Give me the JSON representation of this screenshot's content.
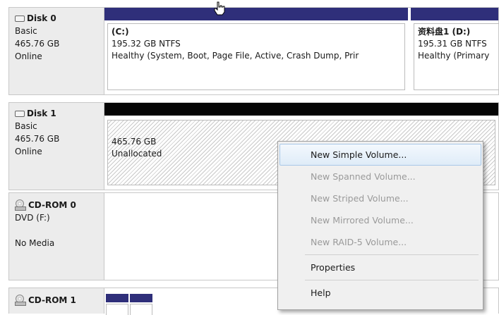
{
  "disks": [
    {
      "name": "Disk 0",
      "type": "Basic",
      "size": "465.76 GB",
      "status": "Online",
      "partitions": [
        {
          "label": "(C:)",
          "size": "195.32 GB NTFS",
          "status": "Healthy (System, Boot, Page File, Active, Crash Dump, Prir"
        },
        {
          "label": "资料盘1 (D:)",
          "size": "195.31 GB NTFS",
          "status": "Healthy (Primary"
        }
      ]
    },
    {
      "name": "Disk 1",
      "type": "Basic",
      "size": "465.76 GB",
      "status": "Online",
      "partitions": [
        {
          "size": "465.76 GB",
          "status": "Unallocated"
        }
      ]
    },
    {
      "name": "CD-ROM 0",
      "type": "DVD (F:)",
      "status": "No Media"
    },
    {
      "name": "CD-ROM 1"
    }
  ],
  "context_menu": {
    "items": [
      {
        "label": "New Simple Volume...",
        "enabled": true
      },
      {
        "label": "New Spanned Volume...",
        "enabled": false
      },
      {
        "label": "New Striped Volume...",
        "enabled": false
      },
      {
        "label": "New Mirrored Volume...",
        "enabled": false
      },
      {
        "label": "New RAID-5 Volume...",
        "enabled": false
      },
      {
        "label": "Properties",
        "enabled": true
      },
      {
        "label": "Help",
        "enabled": true
      }
    ]
  },
  "colors": {
    "primary_partition_bar": "#2f2f7a",
    "unallocated_bar": "#050505",
    "menu_background": "#f0f0f0"
  }
}
